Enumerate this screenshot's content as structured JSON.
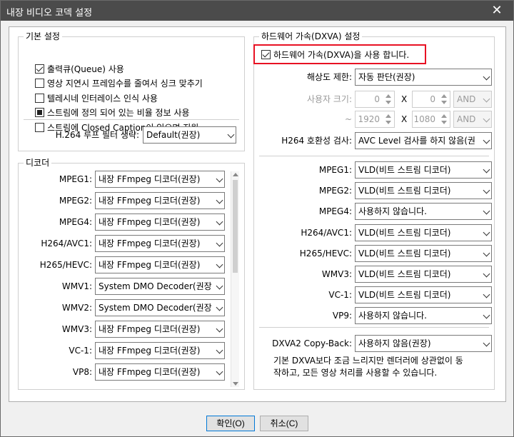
{
  "window": {
    "title": "내장 비디오 코덱 설정",
    "close_glyph": "✕"
  },
  "basic": {
    "title": "기본 설정",
    "items": [
      {
        "label": "출력큐(Queue) 사용",
        "state": "checked"
      },
      {
        "label": "영상 지연시 프레임수를 줄여서 싱크 맞추기",
        "state": "unchecked"
      },
      {
        "label": "텔레시네 인터레이스 인식 사용",
        "state": "unchecked"
      },
      {
        "label": "스트림에 정의 되어 있는 비율 정보 사용",
        "state": "indeterminate"
      },
      {
        "label": "스트림에 Closed Caption이 있으면 지원",
        "state": "unchecked"
      }
    ],
    "h264_loop_label": "H.264 루프 필터 생략:",
    "h264_loop_value": "Default(권장)"
  },
  "decoder": {
    "title": "디코더",
    "rows": [
      {
        "label": "MPEG1:",
        "value": "내장 FFmpeg 디코더(권장)"
      },
      {
        "label": "MPEG2:",
        "value": "내장 FFmpeg 디코더(권장)"
      },
      {
        "label": "MPEG4:",
        "value": "내장 FFmpeg 디코더(권장)"
      },
      {
        "label": "H264/AVC1:",
        "value": "내장 FFmpeg 디코더(권장)"
      },
      {
        "label": "H265/HEVC:",
        "value": "내장 FFmpeg 디코더(권장)"
      },
      {
        "label": "WMV1:",
        "value": "System DMO Decoder(권장"
      },
      {
        "label": "WMV2:",
        "value": "System DMO Decoder(권장"
      },
      {
        "label": "WMV3:",
        "value": "내장 FFmpeg 디코더(권장)"
      },
      {
        "label": "VC-1:",
        "value": "내장 FFmpeg 디코더(권장)"
      },
      {
        "label": "VP8:",
        "value": "내장 FFmpeg 디코더(권장)"
      }
    ]
  },
  "hw": {
    "title": "하드웨어 가속(DXVA) 설정",
    "enable_label": "하드웨어 가속(DXVA)을 사용 합니다.",
    "enable_state": "checked",
    "resolution_label": "해상도 제한:",
    "resolution_value": "자동 판단(권장)",
    "user_size_label": "사용자 크기:",
    "min_w": "0",
    "min_h": "0",
    "min_op": "AND",
    "tilde": "~",
    "max_w": "1920",
    "max_h": "1080",
    "max_op": "AND",
    "x_sep": "X",
    "h264_compat_label": "H264 호환성 검사:",
    "h264_compat_value": "AVC Level 검사를 하지 않음(권",
    "rows": [
      {
        "label": "MPEG1:",
        "value": "VLD(비트 스트림 디코더)"
      },
      {
        "label": "MPEG2:",
        "value": "VLD(비트 스트림 디코더)"
      },
      {
        "label": "MPEG4:",
        "value": "사용하지 않습니다."
      },
      {
        "label": "H264/AVC1:",
        "value": "VLD(비트 스트림 디코더)"
      },
      {
        "label": "H265/HEVC:",
        "value": "VLD(비트 스트림 디코더)"
      },
      {
        "label": "WMV3:",
        "value": "VLD(비트 스트림 디코더)"
      },
      {
        "label": "VC-1:",
        "value": "VLD(비트 스트림 디코더)"
      },
      {
        "label": "VP9:",
        "value": "사용하지 않습니다."
      }
    ],
    "copyback_label": "DXVA2 Copy-Back:",
    "copyback_value": "사용하지 않음(권장)",
    "desc_line1": "기본 DXVA보다 조금 느리지만 렌더러에 상관없이 동",
    "desc_line2": "작하고, 모든 영상 처리를 사용할 수 있습니다."
  },
  "footer": {
    "ok": "확인(O)",
    "cancel": "취소(C)"
  },
  "colors": {
    "titlebar": "#4b4b4b",
    "highlight": "#e81123",
    "focus": "#0078d7"
  }
}
